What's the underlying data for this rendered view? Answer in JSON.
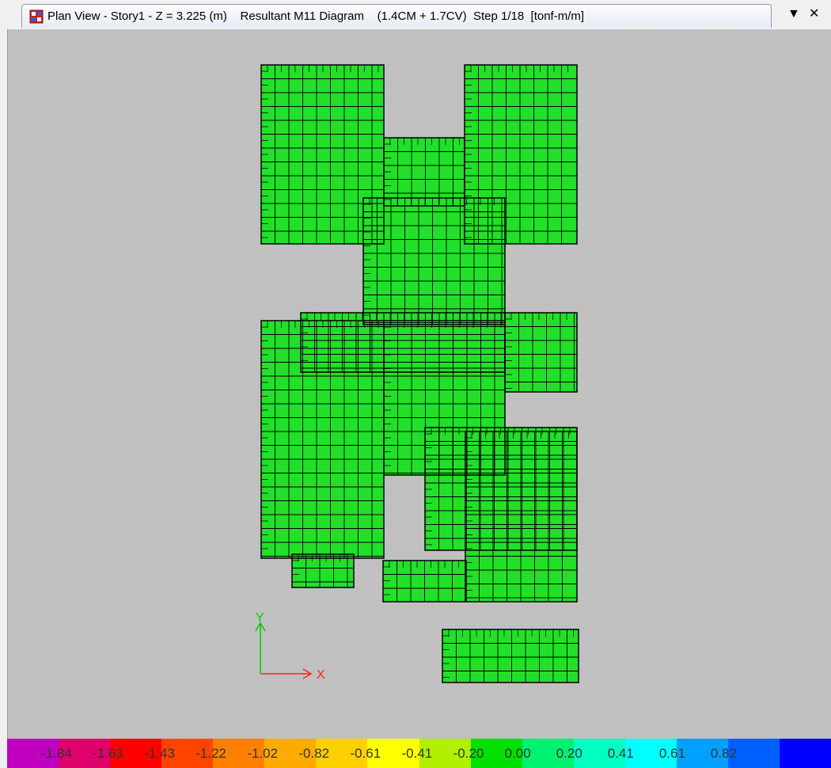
{
  "window": {
    "tab_title": "Plan View - Story1 - Z = 3.225 (m)    Resultant M11 Diagram    (1.4CM + 1.7CV)  Step 1/18  [tonf-m/m]",
    "dropdown_glyph": "▼",
    "close_glyph": "✕"
  },
  "axes": {
    "y_label": "Y",
    "x_label": "X",
    "y_color": "#00cc00",
    "x_color": "#ff2020"
  },
  "legend": {
    "colors": [
      "#c000c0",
      "#e0006c",
      "#ff0000",
      "#ff4400",
      "#ff8000",
      "#ffaa00",
      "#ffd000",
      "#ffff00",
      "#b0f000",
      "#00e000",
      "#00f070",
      "#00ffc0",
      "#00ffff",
      "#00a0ff",
      "#0060ff",
      "#0000ff"
    ],
    "labels": [
      "-1.84",
      "-1.63",
      "-1.43",
      "-1.22",
      "-1.02",
      "-0.82",
      "-0.61",
      "-0.41",
      "-0.20",
      "0.00",
      "0.20",
      "0.41",
      "0.61",
      "0.82"
    ]
  },
  "colors": {
    "slab_base": "#22e02a",
    "canvas_bg": "#c0c0c0"
  }
}
